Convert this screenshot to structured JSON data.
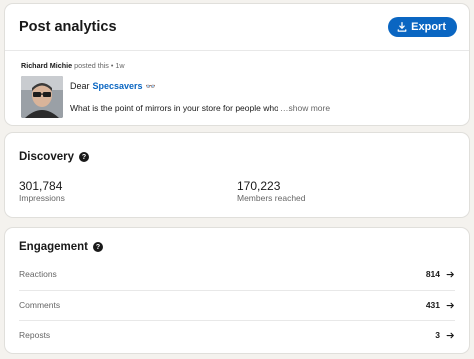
{
  "post_card": {
    "title": "Post analytics",
    "export_label": "Export",
    "author": "Richard Michie",
    "meta_suffix": "posted this • 1w",
    "dear_prefix": "Dear",
    "mention": "Specsavers",
    "emoji": "👓",
    "post_text": "What is the point of mirrors in your store for people who c",
    "show_more": "…show more",
    "accent_color": "#0a66c2"
  },
  "discovery": {
    "title": "Discovery",
    "metrics": [
      {
        "value": "301,784",
        "label": "Impressions"
      },
      {
        "value": "170,223",
        "label": "Members reached"
      }
    ]
  },
  "engagement": {
    "title": "Engagement",
    "rows": [
      {
        "label": "Reactions",
        "value": "814"
      },
      {
        "label": "Comments",
        "value": "431"
      },
      {
        "label": "Reposts",
        "value": "3"
      }
    ]
  }
}
